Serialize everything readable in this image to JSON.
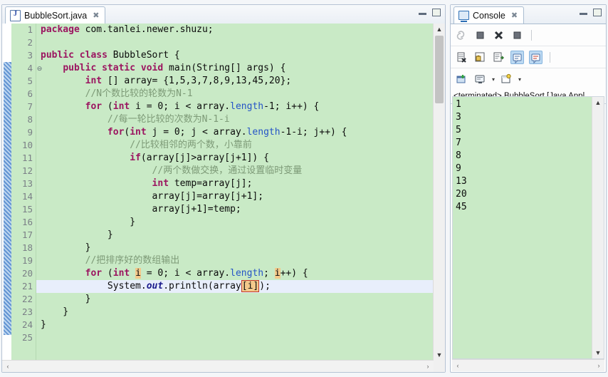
{
  "editor": {
    "tab": {
      "label": "BubbleSort.java",
      "close": "✖",
      "icon": "java-file-icon"
    },
    "window_buttons": {
      "minimize": "minimize-icon",
      "maximize": "maximize-icon"
    },
    "line_numbers": [
      "1",
      "2",
      "3",
      "4",
      "5",
      "6",
      "7",
      "8",
      "9",
      "10",
      "11",
      "12",
      "13",
      "14",
      "15",
      "16",
      "17",
      "18",
      "19",
      "20",
      "21",
      "22",
      "23",
      "24",
      "25"
    ],
    "fold_marker": "⊖",
    "highlighted_line": "21",
    "code_lines": [
      {
        "n": "1",
        "text": "package com.tanlei.newer.shuzu;"
      },
      {
        "n": "2",
        "text": ""
      },
      {
        "n": "3",
        "text": "public class BubbleSort {"
      },
      {
        "n": "4",
        "text": "    public static void main(String[] args) {"
      },
      {
        "n": "5",
        "text": "        int [] array= {1,5,3,7,8,9,13,45,20};"
      },
      {
        "n": "6",
        "text": "        //N个数比较的轮数为N-1"
      },
      {
        "n": "7",
        "text": "        for (int i = 0; i < array.length-1; i++) {"
      },
      {
        "n": "8",
        "text": "            //每一轮比较的次数为N-1-i"
      },
      {
        "n": "9",
        "text": "            for(int j = 0; j < array.length-1-i; j++) {"
      },
      {
        "n": "10",
        "text": "                //比较相邻的两个数，小靠前"
      },
      {
        "n": "11",
        "text": "                if(array[j]>array[j+1]) {"
      },
      {
        "n": "12",
        "text": "                    //两个数做交换，通过设置临时变量"
      },
      {
        "n": "13",
        "text": "                    int temp=array[j];"
      },
      {
        "n": "14",
        "text": "                    array[j]=array[j+1];"
      },
      {
        "n": "15",
        "text": "                    array[j+1]=temp;"
      },
      {
        "n": "16",
        "text": "                }"
      },
      {
        "n": "17",
        "text": "            }"
      },
      {
        "n": "18",
        "text": "        }"
      },
      {
        "n": "19",
        "text": "        //把排序好的数组输出"
      },
      {
        "n": "20",
        "text": "        for (int i = 0; i < array.length; i++) {"
      },
      {
        "n": "21",
        "text": "            System.out.println(array[i]);"
      },
      {
        "n": "22",
        "text": "        }"
      },
      {
        "n": "23",
        "text": "    }"
      },
      {
        "n": "24",
        "text": "}"
      },
      {
        "n": "25",
        "text": ""
      }
    ],
    "scroll": {
      "up": "▲",
      "down": "▼",
      "left": "‹",
      "right": "›"
    }
  },
  "console": {
    "tab": {
      "label": "Console",
      "close": "✖",
      "icon": "console-icon"
    },
    "window_buttons": {
      "minimize": "minimize-icon",
      "maximize": "maximize-icon"
    },
    "toolbar_row1": [
      {
        "name": "relaunch-icon",
        "enabled": "false"
      },
      {
        "name": "terminate-icon",
        "enabled": "true"
      },
      {
        "name": "remove-launch-icon",
        "enabled": "true"
      },
      {
        "name": "remove-all-terminated-icon",
        "enabled": "true"
      }
    ],
    "toolbar_row2": [
      {
        "name": "clear-console-icon",
        "active": "false"
      },
      {
        "name": "scroll-lock-icon",
        "active": "false"
      },
      {
        "name": "pin-console-icon",
        "active": "false"
      },
      {
        "name": "show-console-on-output-icon",
        "active": "true"
      },
      {
        "name": "show-console-on-error-icon",
        "active": "true"
      }
    ],
    "toolbar_row3": [
      {
        "name": "new-console-view-icon",
        "caret": "false"
      },
      {
        "name": "display-selected-console-icon",
        "caret": "true"
      },
      {
        "name": "open-console-icon",
        "caret": "true"
      }
    ],
    "caret_glyph": "▾",
    "status": "<terminated> BubbleSort [Java Appl",
    "output_lines": [
      "1",
      "3",
      "5",
      "7",
      "8",
      "9",
      "13",
      "20",
      "45"
    ],
    "scroll": {
      "up": "▲",
      "down": "▼",
      "left": "‹",
      "right": "›"
    }
  },
  "colors": {
    "code_background": "#c9eac6",
    "keyword": "#9b1560",
    "comment": "#7d9a77",
    "field": "#2554c7",
    "static_field": "#1a1a8c",
    "occurrence": "#f3c98b",
    "toggle_active": "#bcd9f2"
  }
}
